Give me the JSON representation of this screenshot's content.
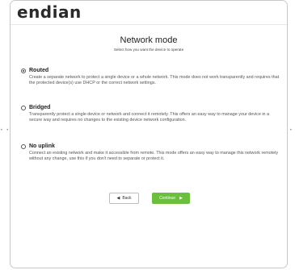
{
  "brand": {
    "logo_text": "endian"
  },
  "page": {
    "title": "Network mode",
    "subtitle": "Select how you want the device to operate"
  },
  "options": [
    {
      "label": "Routed",
      "selected": true,
      "description": "Create a separate network to protect a single device or a whole network. This mode does not work transparently and requires that the protected device(s) use DHCP or the correct network settings."
    },
    {
      "label": "Bridged",
      "selected": false,
      "description": "Transparently protect a single device or network and connect it remotely. This offers an easy way to manage your device in a secure way and requires no changes to the existing device network configuration."
    },
    {
      "label": "No uplink",
      "selected": false,
      "description": "Connect an existing network and make it accessible from remote. This mode offers an easy way to manage this network remotely without any change, use this if you don't need to separate or protect it."
    }
  ],
  "buttons": {
    "back": {
      "label": "Back",
      "icon": "chevron-left-icon"
    },
    "continue": {
      "label": "Continue",
      "icon": "chevron-right-icon"
    }
  },
  "colors": {
    "accent": "#6abf3c",
    "text": "#333333",
    "border": "#c8c8c8"
  }
}
